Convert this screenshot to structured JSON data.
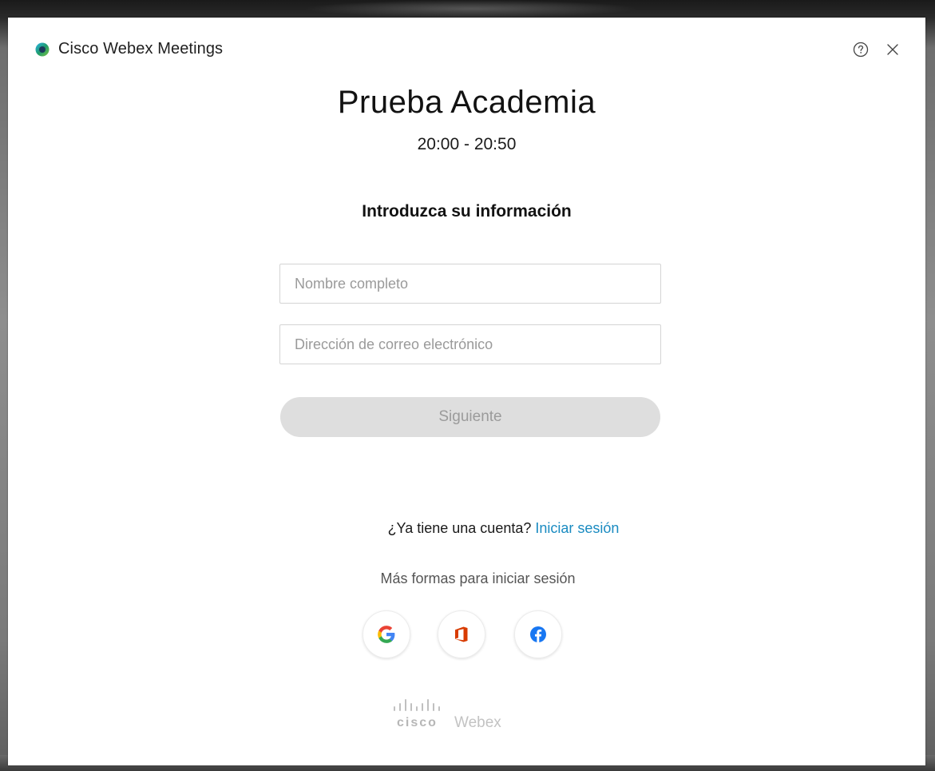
{
  "window": {
    "app_title": "Cisco Webex Meetings",
    "help_icon": "help-circle-icon",
    "close_icon": "close-icon"
  },
  "meeting": {
    "title": "Prueba Academia",
    "time": "20:00 - 20:50"
  },
  "form": {
    "heading": "Introduzca su información",
    "name_placeholder": "Nombre completo",
    "name_value": "",
    "email_placeholder": "Dirección de correo electrónico",
    "email_value": "",
    "next_label": "Siguiente"
  },
  "account": {
    "question": "¿Ya tiene una cuenta?",
    "signin_label": "Iniciar sesión"
  },
  "social": {
    "heading": "Más formas para iniciar sesión",
    "providers": [
      {
        "name": "google",
        "icon": "google-icon"
      },
      {
        "name": "office",
        "icon": "office-icon"
      },
      {
        "name": "facebook",
        "icon": "facebook-icon"
      }
    ]
  },
  "footer": {
    "brand_cisco": "cisco",
    "brand_webex": "Webex"
  },
  "colors": {
    "link": "#1a8bc1",
    "button_disabled_bg": "#dedede",
    "button_disabled_text": "#9b9b9b"
  }
}
